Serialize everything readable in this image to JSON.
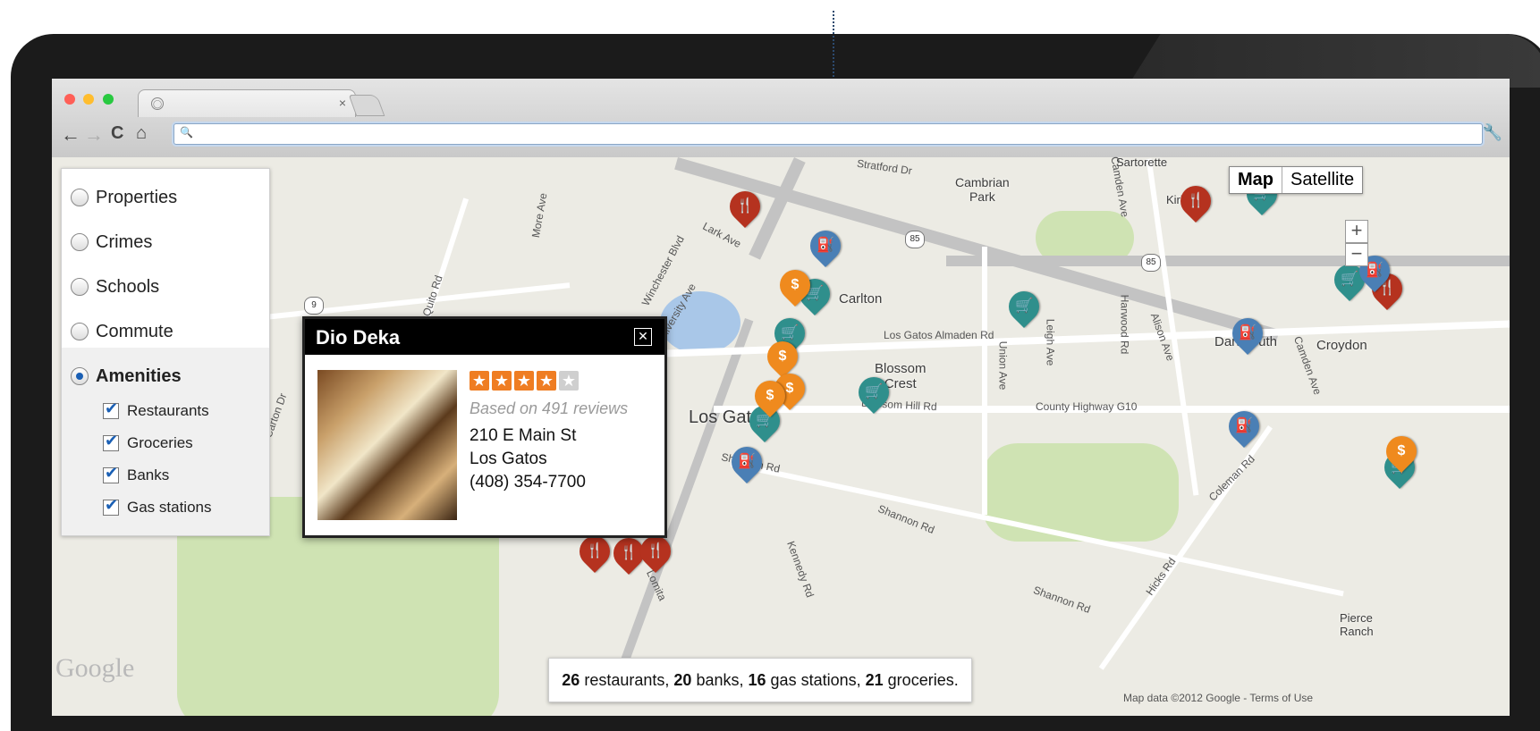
{
  "browser": {
    "window_lights": [
      "#ff5f57",
      "#ffbd2e",
      "#28c940"
    ],
    "tab_favicon": "globe-icon",
    "tab_close": "×",
    "omnibox_icon": "search-icon",
    "omnibox_value": "",
    "back": "←",
    "forward": "→",
    "reload": "C",
    "home": "⌂",
    "wrench": "🔧"
  },
  "layers": {
    "options": [
      {
        "label": "Properties",
        "selected": false
      },
      {
        "label": "Crimes",
        "selected": false
      },
      {
        "label": "Schools",
        "selected": false
      },
      {
        "label": "Commute",
        "selected": false
      },
      {
        "label": "Amenities",
        "selected": true
      }
    ],
    "amenities": [
      {
        "label": "Restaurants",
        "checked": true
      },
      {
        "label": "Groceries",
        "checked": true
      },
      {
        "label": "Banks",
        "checked": true
      },
      {
        "label": "Gas stations",
        "checked": true
      }
    ]
  },
  "popup": {
    "title": "Dio Deka",
    "close": "✕",
    "rating_out_of_5": 4,
    "reviews": "Based on 491 reviews",
    "address_line1": "210 E Main St",
    "address_line2": "Los Gatos",
    "phone": "(408) 354-7700"
  },
  "summary": {
    "restaurants": "26",
    "restaurants_label": "restaurants,",
    "banks": "20",
    "banks_label": "banks,",
    "gas": "16",
    "gas_label": "gas stations,",
    "groceries": "21",
    "groceries_label": "groceries."
  },
  "map_controls": {
    "map": "Map",
    "satellite": "Satellite",
    "zoom_in": "+",
    "zoom_out": "−"
  },
  "map_labels": {
    "cambrian": "Cambrian\nPark",
    "carlton": "Carlton",
    "blossom": "Blossom\nCrest",
    "los_gatos": "Los Gatos",
    "dartmouth": "Dartmouth",
    "croydon": "Croydon",
    "sartorette": "Sartorette",
    "kirk": "Kirk",
    "pierce": "Pierce\nRanch",
    "stratford": "Stratford Dr",
    "lark": "Lark Ave",
    "los_gatos_almaden": "Los Gatos Almaden Rd",
    "blossom_hill": "Blossom Hill Rd",
    "county_hwy": "County Highway G10",
    "shannon": "Shannon Rd",
    "shannon2": "Shannon Rd",
    "shannon3": "Shannon Rd",
    "coleman": "Coleman Rd",
    "hicks": "Hicks Rd",
    "union": "Union Ave",
    "leigh": "Leigh Ave",
    "harwood": "Harwood Rd",
    "alison": "Alison Ave",
    "camden": "Camden Ave",
    "camden2": "Camden Ave",
    "quito": "Quito Rd",
    "winchester": "Winchester Blvd",
    "more": "More Ave",
    "university": "University Ave",
    "kennedy": "Kennedy Rd",
    "lomita": "Lomita",
    "carton": "Carton Dr",
    "route85a": "85",
    "route85b": "85",
    "route9": "9"
  },
  "attribution": {
    "google": "Google",
    "text": "Map data ©2012 Google - Terms of Use"
  },
  "icons": {
    "restaurant": "fork-knife-icon",
    "grocery": "cart-icon",
    "bank": "dollar-icon",
    "gas": "fuel-pump-icon"
  },
  "colors": {
    "restaurant": "#b5321f",
    "grocery": "#2f8f8c",
    "gas": "#4a7fb5",
    "bank": "#ef8a1e"
  }
}
